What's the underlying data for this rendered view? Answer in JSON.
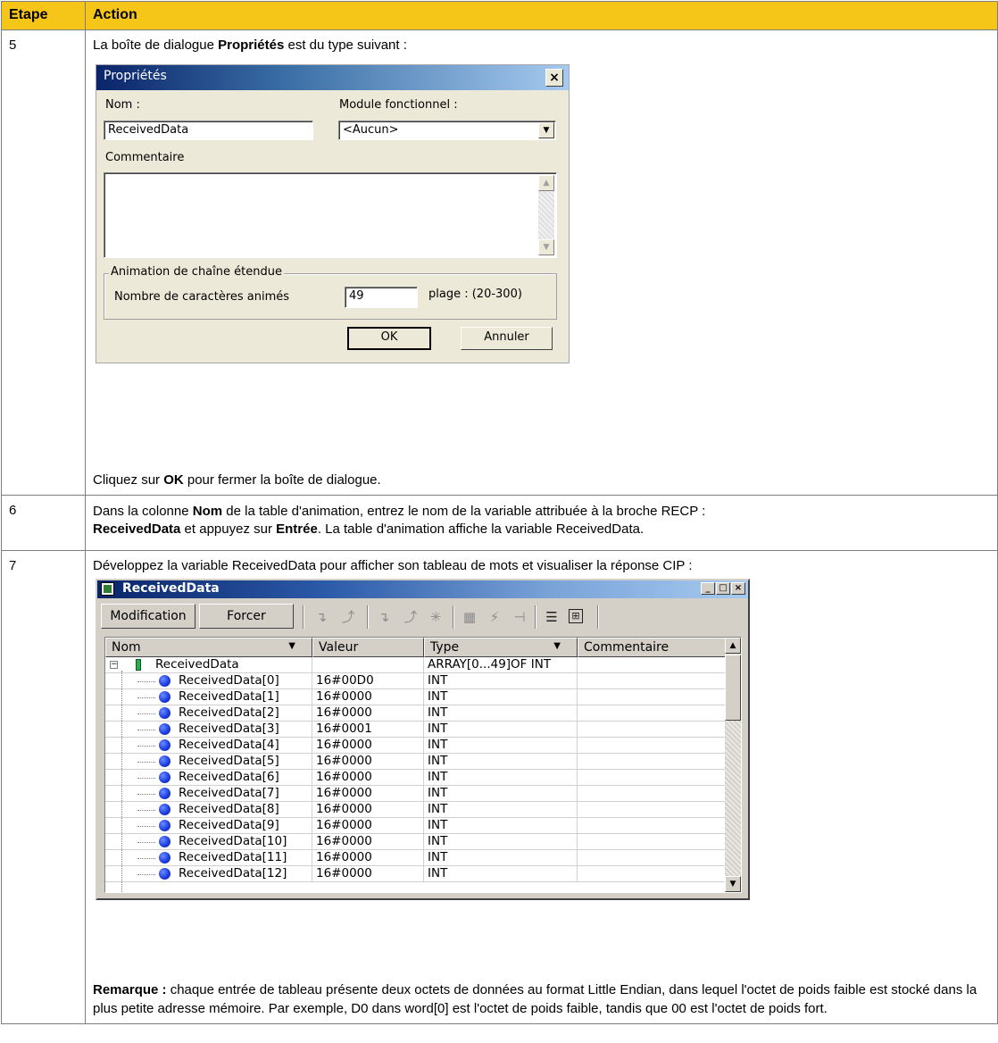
{
  "table": {
    "header_step": "Etape",
    "header_action": "Action"
  },
  "rows": {
    "r5": {
      "step": "5",
      "intro_a": "La boîte de dialogue ",
      "intro_b": "Propriétés",
      "intro_c": " est du type suivant :",
      "outro_a": "Cliquez sur ",
      "outro_b": "OK",
      "outro_c": " pour fermer la boîte de dialogue."
    },
    "r6": {
      "step": "6",
      "t1": "Dans la colonne ",
      "t2": "Nom",
      "t3": " de la table d'animation, entrez le nom de la variable attribuée à la broche RECP :",
      "t4": "ReceivedData",
      "t5": " et appuyez sur ",
      "t6": "Entrée",
      "t7": ". La table d'animation affiche la variable ReceivedData."
    },
    "r7": {
      "step": "7",
      "intro": "Développez la variable ReceivedData pour afficher son tableau de mots et visualiser la réponse CIP :",
      "note_label": "Remarque :",
      "note_text": " chaque entrée de tableau présente deux octets de données au format Little Endian, dans lequel l'octet de poids faible est stocké dans la plus petite adresse mémoire. Par exemple, D0 dans word[0] est l'octet de poids faible, tandis que 00 est l'octet de poids fort."
    }
  },
  "dialog": {
    "title": "Propriétés",
    "close": "×",
    "name_label": "Nom :",
    "name_value": "ReceivedData",
    "module_label": "Module fonctionnel :",
    "module_value": "<Aucun>",
    "comment_label": "Commentaire",
    "comment_value": "",
    "group_label": "Animation de chaîne étendue",
    "chars_label": "Nombre de caractères animés",
    "chars_value": "49",
    "range_label": "plage : (20-300)",
    "ok": "OK",
    "cancel": "Annuler"
  },
  "anim_window": {
    "title": "ReceivedData",
    "btn_modify": "Modification",
    "btn_force": "Forcer",
    "columns": [
      "Nom",
      "Valeur",
      "Type",
      "Commentaire"
    ],
    "parent": {
      "name": "ReceivedData",
      "value": "",
      "type": "ARRAY[0...49]OF INT",
      "comment": ""
    },
    "items": [
      {
        "name": "ReceivedData[0]",
        "value": "16#00D0",
        "type": "INT"
      },
      {
        "name": "ReceivedData[1]",
        "value": "16#0000",
        "type": "INT"
      },
      {
        "name": "ReceivedData[2]",
        "value": "16#0000",
        "type": "INT"
      },
      {
        "name": "ReceivedData[3]",
        "value": "16#0001",
        "type": "INT"
      },
      {
        "name": "ReceivedData[4]",
        "value": "16#0000",
        "type": "INT"
      },
      {
        "name": "ReceivedData[5]",
        "value": "16#0000",
        "type": "INT"
      },
      {
        "name": "ReceivedData[6]",
        "value": "16#0000",
        "type": "INT"
      },
      {
        "name": "ReceivedData[7]",
        "value": "16#0000",
        "type": "INT"
      },
      {
        "name": "ReceivedData[8]",
        "value": "16#0000",
        "type": "INT"
      },
      {
        "name": "ReceivedData[9]",
        "value": "16#0000",
        "type": "INT"
      },
      {
        "name": "ReceivedData[10]",
        "value": "16#0000",
        "type": "INT"
      },
      {
        "name": "ReceivedData[11]",
        "value": "16#0000",
        "type": "INT"
      },
      {
        "name": "ReceivedData[12]",
        "value": "16#0000",
        "type": "INT"
      }
    ]
  },
  "colors": {
    "header_bg": "#f5c518",
    "dialog_bg": "#ece9d8",
    "window_bg": "#d4d0c8",
    "title_blue": "#0a246a"
  }
}
